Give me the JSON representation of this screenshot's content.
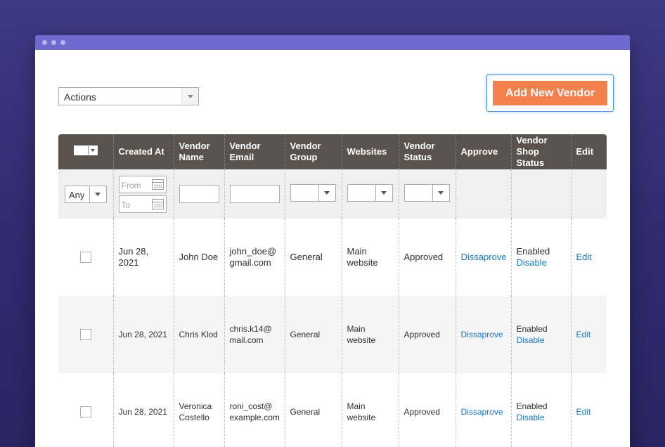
{
  "toolbar": {
    "actions_label": "Actions",
    "add_vendor_label": "Add New Vendor"
  },
  "grid": {
    "columns": [
      "",
      "Created At",
      "Vendor Name",
      "Vendor Email",
      "Vendor Group",
      "Websites",
      "Vendor Status",
      "Approve",
      "Vendor Shop Status",
      "Edit"
    ],
    "filters": {
      "any_label": "Any",
      "date_from_placeholder": "From",
      "date_to_placeholder": "To"
    },
    "rows": [
      {
        "created_at": "Jun 28, 2021",
        "vendor_name": "John Doe",
        "vendor_email": "john_doe@ gmail.com",
        "vendor_group": "General",
        "websites": "Main website",
        "vendor_status": "Approved",
        "approve": "Dissaprove",
        "shop_status": "Enabled",
        "shop_action": "Disable",
        "edit": "Edit"
      },
      {
        "created_at": "Jun 28, 2021",
        "vendor_name": "Chris Klod",
        "vendor_email": "chris.k14@ mail.com",
        "vendor_group": "General",
        "websites": "Main website",
        "vendor_status": "Approved",
        "approve": "Dissaprove",
        "shop_status": "Enabled",
        "shop_action": "Disable",
        "edit": "Edit"
      },
      {
        "created_at": "Jun 28, 2021",
        "vendor_name": "Veronica Costello",
        "vendor_email": "roni_cost@ example.com",
        "vendor_group": "General",
        "websites": "Main website",
        "vendor_status": "Approved",
        "approve": "Dissaprove",
        "shop_status": "Enabled",
        "shop_action": "Disable",
        "edit": "Edit"
      }
    ]
  },
  "colors": {
    "background": "#3d3a86",
    "titlebar": "#6e6ad0",
    "header": "#5a524c",
    "accent_button": "#f4804c",
    "link": "#1979c3"
  }
}
